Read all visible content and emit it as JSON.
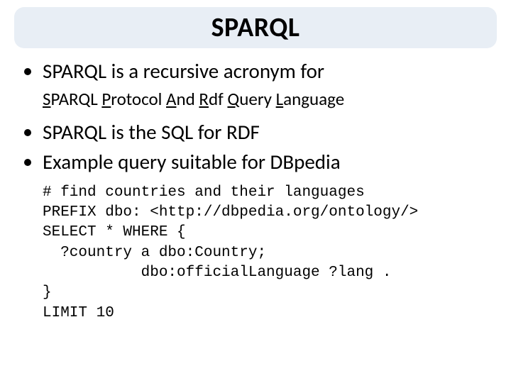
{
  "title": "SPARQL",
  "bullet1": "SPARQL is a recursive acronym for",
  "acronym": {
    "s": "S",
    "sr": "PARQL ",
    "p": "P",
    "pr": "rotocol ",
    "a": "A",
    "ar": "nd ",
    "r": "R",
    "rr": "df ",
    "q": "Q",
    "qr": "uery ",
    "l": "L",
    "lr": "anguage"
  },
  "bullet2": "SPARQL is the SQL for RDF",
  "bullet3": "Example query suitable for DBpedia",
  "code": {
    "l1": "# find countries and their languages",
    "l2": "PREFIX dbo: <http://dbpedia.org/ontology/>",
    "l3": "SELECT * WHERE {",
    "l4": "  ?country a dbo:Country;",
    "l5": "           dbo:officialLanguage ?lang .",
    "l6": "}",
    "l7": "LIMIT 10"
  }
}
